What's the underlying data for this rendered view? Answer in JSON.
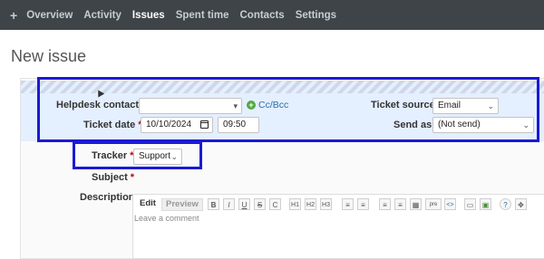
{
  "nav": {
    "plus": "+",
    "items": [
      "Overview",
      "Activity",
      "Issues",
      "Spent time",
      "Contacts",
      "Settings"
    ],
    "active": "Issues"
  },
  "page": {
    "title": "New issue"
  },
  "helpdesk": {
    "contact_label": "Helpdesk contact",
    "contact_value": "",
    "ccbcc": "Cc/Bcc",
    "ticket_source_label": "Ticket source",
    "ticket_source_value": "Email",
    "ticket_date_label": "Ticket date",
    "ticket_date_value": "10/10/2024",
    "ticket_time_value": "09:50",
    "send_as_label": "Send as",
    "send_as_value": "(Not send)"
  },
  "form": {
    "required_mark": "*",
    "tracker_label": "Tracker",
    "tracker_value": "Support",
    "subject_label": "Subject",
    "description_label": "Description"
  },
  "editor": {
    "tab_edit": "Edit",
    "tab_preview": "Preview",
    "toolbar": [
      "B",
      "I",
      "U",
      "S",
      "C",
      "H1",
      "H2",
      "H3",
      "≡",
      "≡",
      "≡",
      "≡",
      "▦",
      "pre",
      "<>",
      "▭",
      "▣",
      "?",
      "✥"
    ],
    "placeholder": "Leave a comment"
  },
  "colors": {
    "highlight_frame": "#1a1ad6",
    "nav_bg": "#3e4448",
    "helpdesk_bg": "#e4efff",
    "required": "#bb0000",
    "link": "#2a6fa8"
  }
}
